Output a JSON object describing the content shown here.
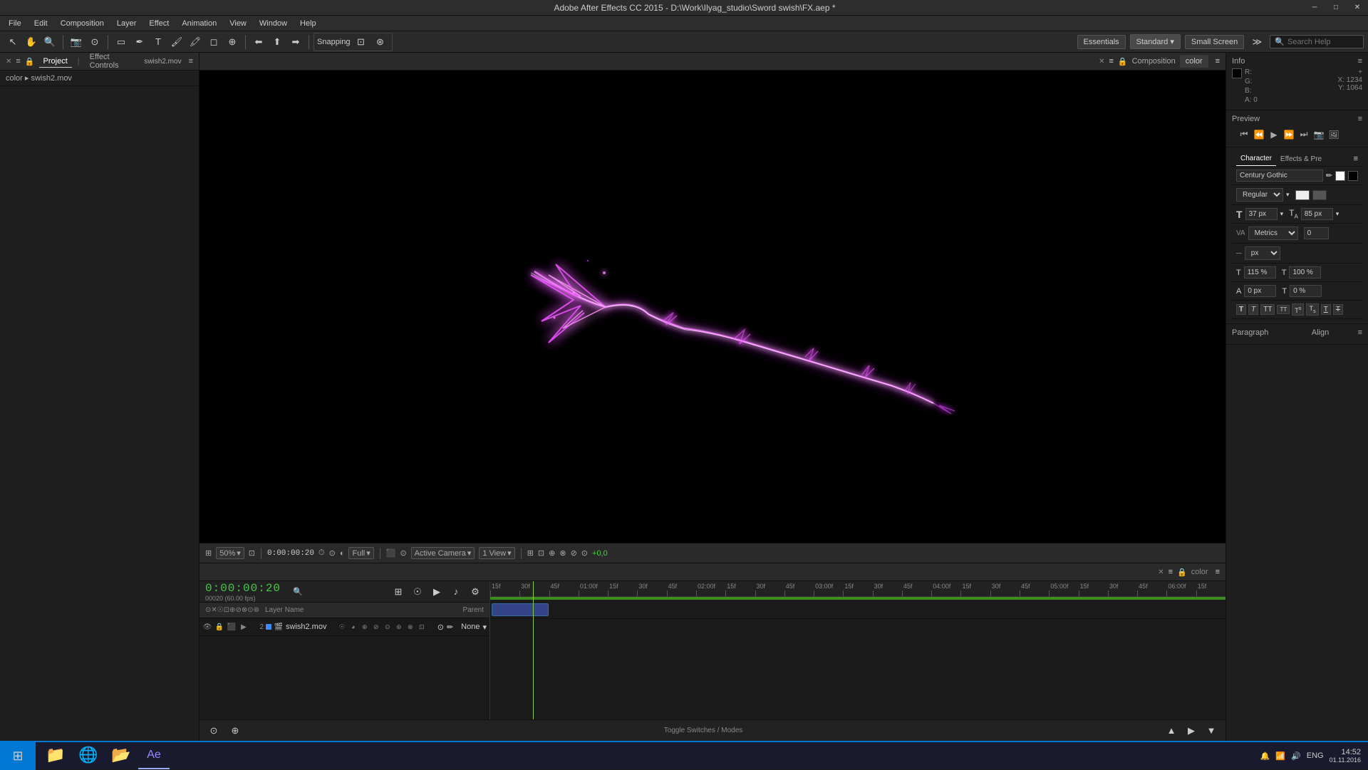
{
  "app": {
    "title": "Adobe After Effects CC 2015 - D:\\Work\\Ilyag_studio\\Sword swish\\FX.aep *"
  },
  "window_controls": {
    "minimize": "─",
    "maximize": "□",
    "close": "✕"
  },
  "menu": {
    "items": [
      "File",
      "Edit",
      "Composition",
      "Layer",
      "Effect",
      "Animation",
      "View",
      "Window",
      "Help"
    ]
  },
  "toolbar": {
    "workspace": [
      "Essentials",
      "Standard",
      "Small Screen"
    ],
    "search_placeholder": "Search Help",
    "snapping": "Snapping"
  },
  "left_panel": {
    "project_tab": "Project",
    "effect_controls_tab": "Effect Controls",
    "file_name": "swish2.mov",
    "label": "color ▸ swish2.mov"
  },
  "comp_panel": {
    "title": "Composition",
    "tab_name": "color",
    "viewer_controls": {
      "zoom": "50%",
      "timecode": "0:00:00:20",
      "quality": "Full",
      "camera": "Active Camera",
      "view": "1 View",
      "green_num": "+0,0"
    }
  },
  "timeline": {
    "comp_name": "color",
    "timecode": "0:00:00:20",
    "fps": "00020 (60.00 fps)",
    "columns": {
      "layer_name": "Layer Name",
      "parent": "Parent"
    },
    "layers": [
      {
        "num": 2,
        "name": "swish2.mov",
        "color": "#4488ff",
        "solo": false,
        "visible": true,
        "parent": "None"
      }
    ],
    "ruler_marks": [
      "15f",
      "30f",
      "45f",
      "01:00f",
      "15f",
      "30f",
      "45f",
      "02:00f",
      "15f",
      "30f",
      "45f",
      "03:00f",
      "15f",
      "30f",
      "45f",
      "04:00f",
      "15f",
      "30f",
      "45f",
      "05:00f",
      "15f",
      "30f",
      "45f",
      "06:00f",
      "15f"
    ]
  },
  "right_panel": {
    "info": {
      "title": "Info",
      "r": "R:",
      "g": "G:",
      "b": "B:",
      "a": "A: 0",
      "r_val": "",
      "g_val": "",
      "b_val": "",
      "x": "X: 1234",
      "y": "Y: 1064"
    },
    "preview": {
      "title": "Preview",
      "buttons": [
        "⏮",
        "⏪",
        "▶",
        "⏩",
        "⏭"
      ]
    },
    "character": {
      "title": "Character",
      "tab2": "Effects & Pre",
      "font": "Century Gothic",
      "style": "Regular",
      "size": "37 px",
      "kerning": "85 px",
      "metrics": "Metrics",
      "tracking": "0",
      "unit": "px",
      "leading": "115 %",
      "tsscale": "100 %",
      "baseline": "0 px",
      "bsscale": "0 %"
    },
    "paragraph": {
      "title": "Paragraph",
      "align": "Align"
    }
  },
  "bottom_bar": {
    "toggle_label": "Toggle Switches / Modes"
  },
  "taskbar": {
    "time": "14:52",
    "date": "01.11.2016",
    "lang": "ENG",
    "apps": [
      "🪟",
      "📁",
      "🌐",
      "📁",
      "🎬"
    ]
  }
}
